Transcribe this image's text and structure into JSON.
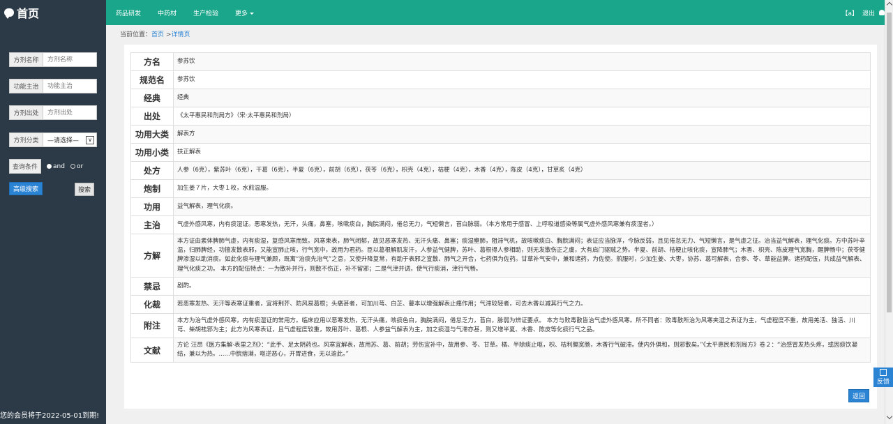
{
  "sidebar": {
    "logo": "首页",
    "fields": [
      {
        "label": "方剂名称",
        "placeholder": "方剂名称"
      },
      {
        "label": "功能主治",
        "placeholder": "功能主治"
      },
      {
        "label": "方剂出处",
        "placeholder": "方剂出处"
      }
    ],
    "category": {
      "label": "方剂分类",
      "selected": "—请选择—"
    },
    "query": {
      "label": "查询条件",
      "and": "and",
      "or": "or"
    },
    "advanced_button": "高级搜索",
    "search_button": "搜索",
    "member_notice": "您的会员将于2022-05-01到期!"
  },
  "topbar": {
    "nav": [
      "药品研发",
      "中药材",
      "生产检验",
      "更多"
    ],
    "user": "【a】",
    "logout": "退出"
  },
  "breadcrumb": {
    "prefix": "当前位置：",
    "home": "首页",
    "sep": " >",
    "current": "详情页"
  },
  "detail_rows": [
    {
      "key": "方名",
      "value": "参苏饮"
    },
    {
      "key": "规范名",
      "value": "参苏饮"
    },
    {
      "key": "经典",
      "value": "经典"
    },
    {
      "key": "出处",
      "value": "《太平惠民和剂局方》（宋·太平惠民和剂局）"
    },
    {
      "key": "功用大类",
      "value": "解表方"
    },
    {
      "key": "功用小类",
      "value": "扶正解表"
    },
    {
      "key": "处方",
      "value": "人参（6克），紫苏叶（6克），干葛（6克），半夏（6克），前胡（6克），茯苓（6克），枳壳（4克），桔梗（4克），木香（4克），陈皮（4克），甘草炙（4克）"
    },
    {
      "key": "炮制",
      "value": "加生姜７片，大枣１枚，水煎温服。"
    },
    {
      "key": "功用",
      "value": "益气解表，理气化痰。"
    },
    {
      "key": "主治",
      "value": "气虚外感风寒，内有痰湿证。恶寒发热，无汗，头痛，鼻塞，咳嗽痰白，胸脘满闷，倦怠无力，气短懒言，苔白脉弱。（本方常用于感冒、上呼吸道感染等属气虚外感风寒兼有痰湿者。）"
    },
    {
      "key": "方解",
      "value": "本方证由素体脾肺气虚，内有痰湿，复感风寒而致。风寒束表，肺气闭郁，故见恶寒发热、无汗头痛、鼻塞；痰湿壅肺，阻滞气机，故咳嗽痰白、胸脘满闷；表证应当脉浮，今脉反弱，且见倦怠无力、气短懒言，是气虚之征。治当益气解表，理气化痰。方中苏叶辛温，归肺脾经，功擅发散表邪，又能宣肺止咳，行气宽中，故用为君药。臣以葛根解肌发汗，人参益气健脾，苏叶、葛根得人参相助，则无发散伤正之虞，大有启门驱贼之势。半夏、前胡、桔梗止咳化痰，宣降肺气；木香、枳壳、陈皮理气宽胸，醒脾畅中；茯苓健脾渗湿以助消痰。如此化痰与理气兼顾，既寓“治痰先治气”之意，又使升降复常，有助于表邪之宣散、肺气之开合，七药俱为佐药。甘草补气安中，兼和诸药，为佐使。煎服时，少加生姜、大枣，协苏、葛可解表，合参、苓、草能益脾。诸药配伍，共成益气解表、理气化痰之功。 本方的配伍特点：一为散补并行，则散不伤正，补不留邪；二是气津并调，使气行痰消，津行气畅。"
    },
    {
      "key": "禁忌",
      "value": "剧酌。"
    },
    {
      "key": "化裁",
      "value": "若恶寒发热、无汗等表寒证重者，宜将荆芥、防风易葛根；头痛甚者，可加川芎、白芷、蔓本以增强解表止痛作用；气滞较轻者，可去木香以减其行气之力。"
    },
    {
      "key": "附注",
      "value": "本方为治气虚外感风寒，内有痰湿证的常用方。临床应用以恶寒发热，无汗头痛，咳痰色白，胸脘满闷，倦怠乏力，苔白，脉弱为辨证要点。 本方与败毒散皆治气虚外感风寒。所不同者：败毒散所治为风寒夹湿之表证为主，气虚程度不重，故用羌活、独活、川芎、柴胡祛邪为主；此方为风寒表证，且气虚程度较重，故用苏叶、葛根、人参益气解表为主，加之痰湿与气滞亦甚，则又增半夏、木香、陈皮等化痰行气之品。"
    },
    {
      "key": "文献",
      "value": "方论 汪昂《医方集解·表里之剂》：“此手、足太阴药也。风寒宜解表，故用苏、葛、前胡；劳伤宜补中，故用参、苓、甘草。橘、半除痰止呕，枳、桔利膈宽肠，木香行气破滞。使内外俱和，则邪散矣。”《太平惠民和剂局方》卷２：“治感冒发热头疼，或因痰饮凝结，兼以为热。......中脘痞满，呕逆恶心，开胃进食，无以逾此。”"
    }
  ],
  "back_button": "返回",
  "feedback": "反馈"
}
